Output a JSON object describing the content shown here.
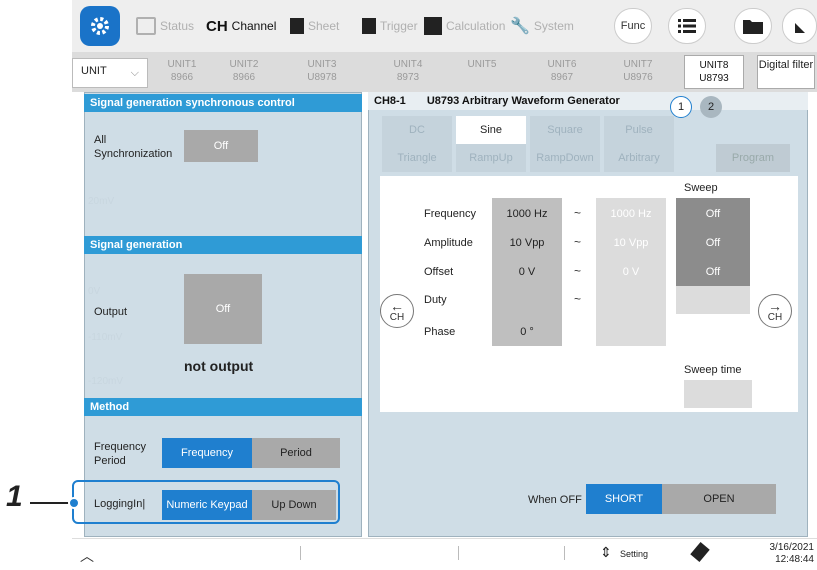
{
  "toolbar": {
    "settings_icon": "gear-icon",
    "tabs": [
      {
        "label": "Status",
        "icon": "status-icon"
      },
      {
        "label_big": "CH",
        "label": "Channel",
        "icon": "channel-icon"
      },
      {
        "label": "Sheet",
        "icon": "sheet-icon"
      },
      {
        "label": "Trigger",
        "icon": "trigger-icon"
      },
      {
        "label": "Calculation",
        "icon": "calculation-icon"
      },
      {
        "label": "System",
        "icon": "system-icon"
      }
    ],
    "func_label": "Func",
    "list_icon": "list-icon",
    "folder_icon": "folder-icon"
  },
  "unit_row": {
    "selector_value": "UNIT",
    "units": [
      {
        "name": "UNIT1",
        "model": "8966"
      },
      {
        "name": "UNIT2",
        "model": "8966"
      },
      {
        "name": "UNIT3",
        "model": "U8978"
      },
      {
        "name": "UNIT4",
        "model": "8973"
      },
      {
        "name": "UNIT5",
        "model": ""
      },
      {
        "name": "UNIT6",
        "model": "8967"
      },
      {
        "name": "UNIT7",
        "model": "U8976"
      },
      {
        "name": "UNIT8",
        "model": "U8793"
      }
    ],
    "digital_filter_label": "Digital filter"
  },
  "left_panel": {
    "sync_header": "Signal generation synchronous control",
    "all_sync_label": "All Synchronization",
    "all_sync_value": "Off",
    "siggen_header": "Signal generation",
    "output_label": "Output",
    "output_value": "Off",
    "output_status": "not output",
    "method_header": "Method",
    "freq_period_label": "Frequency Period",
    "freq_option": "Frequency",
    "period_option": "Period",
    "logging_label": "LoggingIn|",
    "numeric_option": "Numeric Keypad",
    "updown_option": "Up Down",
    "bg_values": [
      "100mV",
      "20mV",
      "0V",
      "-110mV",
      "-120mV"
    ]
  },
  "right_panel": {
    "channel": "CH8-1",
    "title": "U8793 Arbitrary Waveform Generator",
    "pages": [
      "1",
      "2"
    ],
    "waveforms_row1": [
      "DC",
      "Sine",
      "Square",
      "Pulse"
    ],
    "waveforms_row2": [
      "Triangle",
      "RampUp",
      "RampDown",
      "Arbitrary"
    ],
    "program_label": "Program",
    "sweep_header": "Sweep",
    "params": [
      {
        "label": "Frequency",
        "value": "1000 Hz",
        "end": "1000 Hz",
        "sweep": "Off"
      },
      {
        "label": "Amplitude",
        "value": "10 Vpp",
        "end": "10 Vpp",
        "sweep": "Off"
      },
      {
        "label": "Offset",
        "value": "0 V",
        "end": "0 V",
        "sweep": "Off"
      },
      {
        "label": "Duty",
        "value": "",
        "end": "",
        "sweep": ""
      },
      {
        "label": "Phase",
        "value": "0 °",
        "end": "",
        "sweep": ""
      }
    ],
    "tilde": "~",
    "prev_ch": "CH",
    "next_ch": "CH",
    "sweep_time_label": "Sweep time",
    "when_off_label": "When OFF",
    "short_option": "SHORT",
    "open_option": "OPEN"
  },
  "callout_number": "1",
  "bottom": {
    "setting_label": "Setting",
    "date": "3/16/2021",
    "time": "12:48:44"
  }
}
